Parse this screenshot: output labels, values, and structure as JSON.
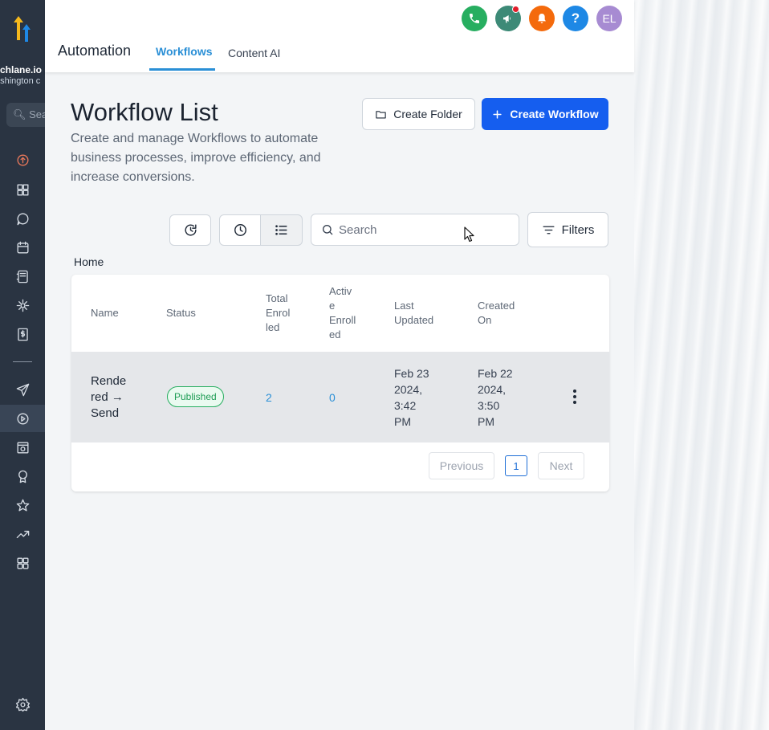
{
  "colors": {
    "sidebar_bg": "#2a3442",
    "accent_blue": "#155eef",
    "tab_active": "#2a8fd6",
    "published_green": "#27ae60"
  },
  "sidebar": {
    "account_name": "tchlane.io",
    "account_location": "ashington c",
    "search_placeholder": "Sea",
    "items": [
      {
        "icon": "launchpad-icon"
      },
      {
        "icon": "dashboard-icon"
      },
      {
        "icon": "conversations-icon"
      },
      {
        "icon": "calendar-icon"
      },
      {
        "icon": "contacts-icon"
      },
      {
        "icon": "opportunities-icon"
      },
      {
        "icon": "payments-icon"
      },
      {
        "icon": "marketing-icon"
      },
      {
        "icon": "automation-icon",
        "active": true
      },
      {
        "icon": "sites-icon"
      },
      {
        "icon": "memberships-icon"
      },
      {
        "icon": "reputation-icon"
      },
      {
        "icon": "reporting-icon"
      },
      {
        "icon": "app-marketplace-icon"
      },
      {
        "icon": "settings-icon"
      }
    ]
  },
  "header": {
    "module_title": "Automation",
    "tabs": [
      {
        "label": "Workflows",
        "active": true
      },
      {
        "label": "Content AI",
        "active": false
      }
    ],
    "icons": [
      {
        "name": "phone-icon",
        "color": "#27ae60"
      },
      {
        "name": "megaphone-icon",
        "color": "#3d8a77",
        "badge": true
      },
      {
        "name": "bell-icon",
        "color": "#f46a0c"
      },
      {
        "name": "help-icon",
        "color": "#1e88e5",
        "text": "?"
      },
      {
        "name": "avatar",
        "color": "#a78bd2",
        "text": "EL"
      }
    ]
  },
  "main": {
    "title": "Workflow List",
    "description": "Create and manage Workflows to automate business processes, improve efficiency, and increase conversions.",
    "create_folder_label": "Create Folder",
    "create_workflow_label": "Create Workflow",
    "search_placeholder": "Search",
    "filters_label": "Filters",
    "breadcrumb": "Home"
  },
  "table": {
    "columns": {
      "name": "Name",
      "status": "Status",
      "total_enrolled": "Total\nEnrol\nled",
      "active_enrolled": "Activ\ne\nEnroll\ned",
      "last_updated": "Last\nUpdated",
      "created_on": "Created\nOn"
    },
    "rows": [
      {
        "name": "Rende\nred →\nSend",
        "status": "Published",
        "total_enrolled": "2",
        "active_enrolled": "0",
        "last_updated": "Feb 23\n2024,\n3:42\nPM",
        "created_on": "Feb 22\n2024,\n3:50\nPM"
      }
    ]
  },
  "pagination": {
    "previous": "Previous",
    "page": "1",
    "next": "Next"
  }
}
